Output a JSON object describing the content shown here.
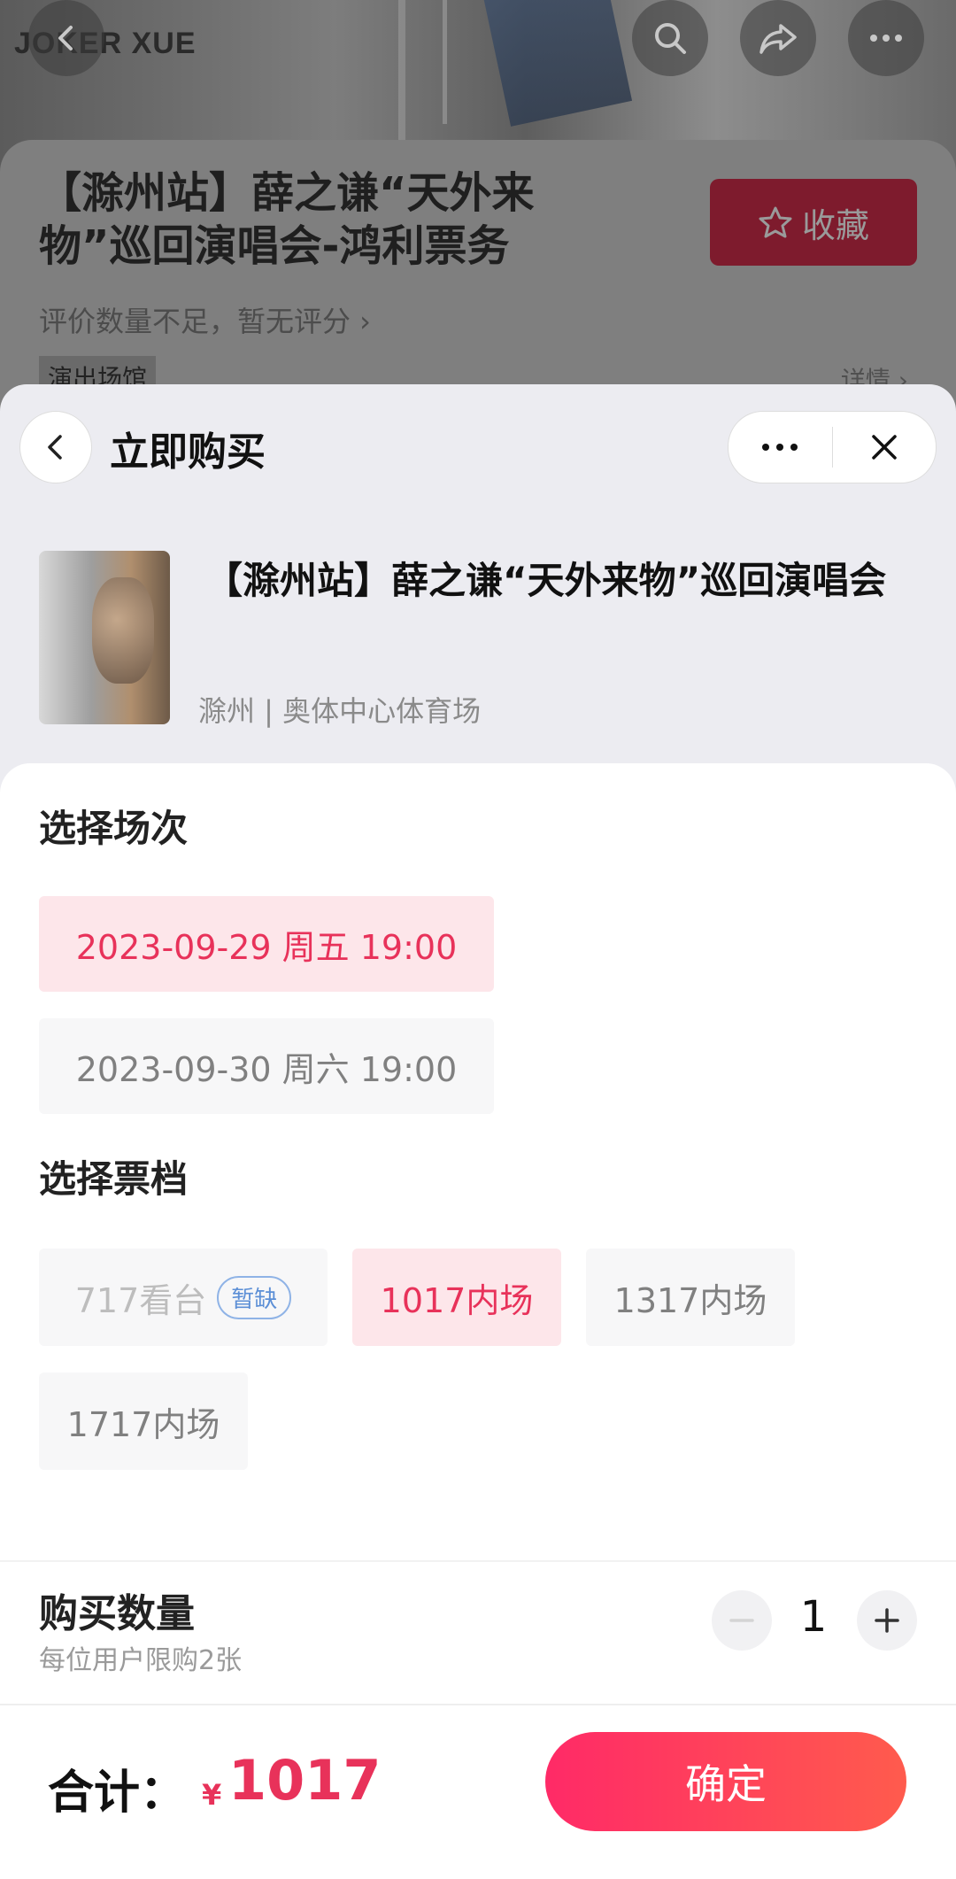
{
  "background_page": {
    "hero_logo": "JOKER XUE",
    "title": "【滁州站】薛之谦“天外来物”巡回演唱会-鸿利票务",
    "favorite_label": "收藏",
    "rating_text": "评价数量不足，暂无评分 ›",
    "venue_tag": "演出场馆",
    "detail_link": "详情 ›"
  },
  "sheet": {
    "title": "立即购买",
    "event": {
      "title": "【滁州站】薛之谦“天外来物”巡回演唱会",
      "venue": "滁州 | 奥体中心体育场"
    },
    "session_section_title": "选择场次",
    "sessions": [
      {
        "label": "2023-09-29 周五 19:00",
        "state": "selected"
      },
      {
        "label": "2023-09-30 周六 19:00",
        "state": "normal"
      }
    ],
    "tier_section_title": "选择票档",
    "tiers": [
      {
        "label": "717看台",
        "state": "disabled",
        "badge": "暂缺"
      },
      {
        "label": "1017内场",
        "state": "selected"
      },
      {
        "label": "1317内场",
        "state": "normal"
      },
      {
        "label": "1717内场",
        "state": "normal"
      }
    ],
    "quantity": {
      "label": "购买数量",
      "note": "每位用户限购2张",
      "value": "1"
    }
  },
  "footer": {
    "total_label": "合计：",
    "currency": "¥",
    "total_value": "1017",
    "confirm_label": "确定"
  },
  "colors": {
    "accent": "#e8325a",
    "selected_bg": "#fde6ea",
    "chip_bg": "#f7f7f8",
    "badge": "#5c8fd6"
  },
  "icons": [
    "back-arrow-icon",
    "search-icon",
    "share-icon",
    "more-icon",
    "star-icon",
    "close-icon",
    "minus-icon",
    "plus-icon"
  ]
}
